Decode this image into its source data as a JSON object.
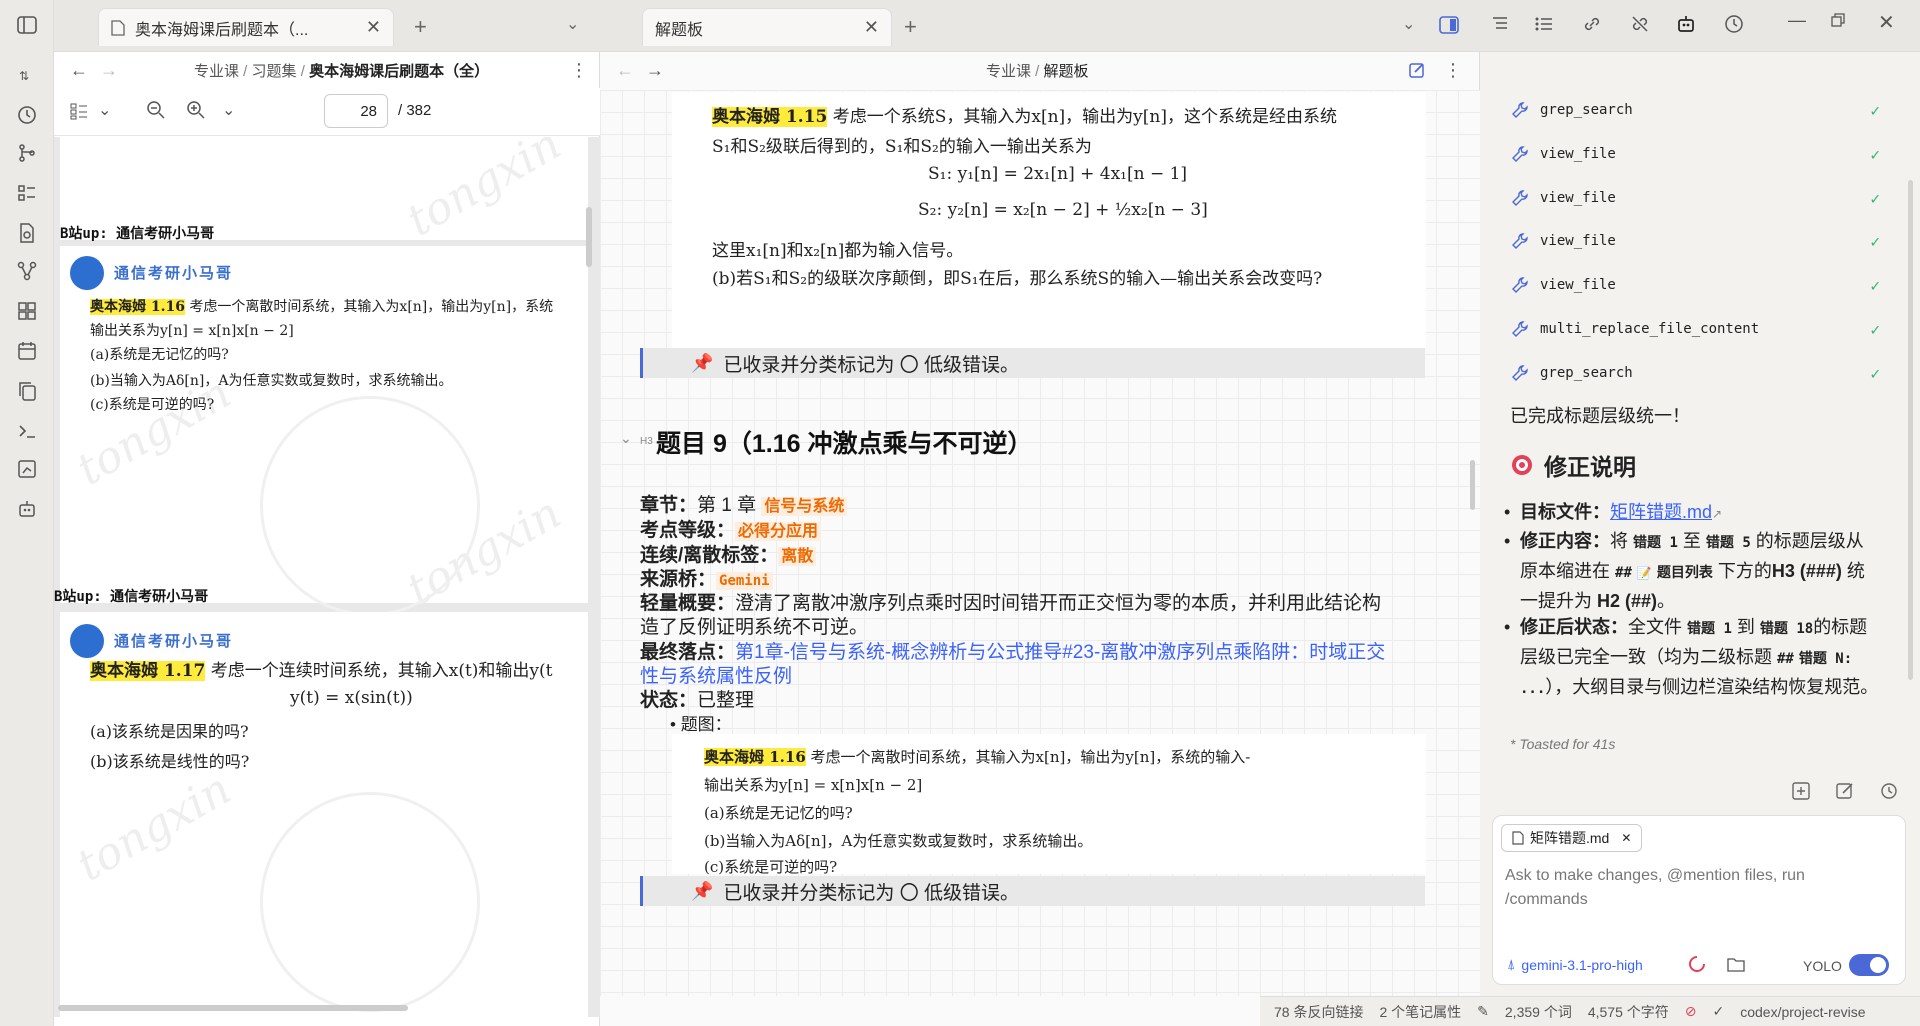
{
  "left_pane": {
    "tab_title": "奥本海姆课后刷题本（...",
    "breadcrumb": [
      "专业课",
      "习题集",
      "奥本海姆课后刷题本（全）"
    ],
    "page_current": "28",
    "page_total": "/ 382",
    "page1": {
      "bup": "B站up: 通信考研小马哥"
    },
    "page2": {
      "ornate": "通信考研小马哥",
      "q_tag": "奥本海姆 1.16",
      "q_line1": "考虑一个离散时间系统，其输入为x[n]，输出为y[n]，系统",
      "q_line2": "输出关系为y[n] = x[n]x[n − 2]",
      "a": "(a)系统是无记忆的吗?",
      "b": "(b)当输入为Aδ[n]，A为任意实数或复数时，求系统输出。",
      "c": "(c)系统是可逆的吗?",
      "bup": "B站up: 通信考研小马哥"
    },
    "page3": {
      "ornate": "通信考研小马哥",
      "q_tag": "奥本海姆 1.17",
      "q_line1": "考虑一个连续时间系统，其输入x(t)和输出y(t",
      "q_eq": "y(t) = x(sin(t))",
      "a": "(a)该系统是因果的吗?",
      "b": "(b)该系统是线性的吗?"
    },
    "watermark": "tongxin"
  },
  "editor": {
    "tab_title": "解题板",
    "breadcrumb": [
      "专业课",
      "解题板"
    ],
    "img1": {
      "q_tag": "奥本海姆 1.15",
      "line1": "考虑一个系统S，其输入为x[n]，输出为y[n]，这个系统是经由系统",
      "line2": "S₁和S₂级联后得到的，S₁和S₂的输入一输出关系为",
      "eq1": "S₁: y₁[n] = 2x₁[n] + 4x₁[n − 1]",
      "eq2": "S₂: y₂[n] = x₂[n − 2] + ½x₂[n − 3]",
      "line3": "这里x₁[n]和x₂[n]都为输入信号。",
      "line4": "(b)若S₁和S₂的级联次序颠倒，即S₁在后，那么系统S的输入—输出关系会改变吗?"
    },
    "callout1": "已收录并分类标记为 〇 低级错误。",
    "heading_marker": "H3",
    "heading": "题目 9（1.16 冲激点乘与不可逆）",
    "fields": {
      "chapter_label": "章节：",
      "chapter_value": "第 1 章 ",
      "chapter_tag": "信号与系统",
      "level_label": "考点等级：",
      "level_tag": "必得分应用",
      "cd_label": "连续/离散标签：",
      "cd_tag": "离散",
      "source_label": "来源桥：",
      "source_tag": "Gemini",
      "summary_label": "轻量概要：",
      "summary_l1": "澄清了离散冲激序列点乘时因时间错开而正交恒为零的本质，并利用此结论构",
      "summary_l2": "造了反例证明系统不可逆。",
      "final_label": "最终落点：",
      "final_l1": "第1章-信号与系统-概念辨析与公式推导#23-离散冲激序列点乘陷阱：时域正交",
      "final_l2": "性与系统属性反例",
      "status_label": "状态：",
      "status_value": "已整理",
      "img_label": "题图："
    },
    "img2": {
      "q_tag": "奥本海姆 1.16",
      "line1": "考虑一个离散时间系统，其输入为x[n]，输出为y[n]，系统的输入-",
      "line2": "输出关系为y[n] = x[n]x[n − 2]",
      "a": "(a)系统是无记忆的吗?",
      "b": "(b)当输入为Aδ[n]，A为任意实数或复数时，求系统输出。",
      "c": "(c)系统是可逆的吗?"
    },
    "callout2": "已收录并分类标记为 〇 低级错误。"
  },
  "agent": {
    "tools": [
      "grep_search",
      "view_file",
      "view_file",
      "view_file",
      "view_file",
      "multi_replace_file_content",
      "grep_search"
    ],
    "done_msg": "已完成标题层级统一！",
    "section_icon": "target-icon",
    "section_title": "修正说明",
    "b1_label": "目标文件：",
    "b1_link": "矩阵错题.md",
    "b2_label": "修正内容：",
    "b2_t1": "将 ",
    "b2_m1": "错题 1",
    "b2_t2": " 至 ",
    "b2_m2": "错题 5",
    "b2_t3": " 的标题层级从原本缩进在 ",
    "b2_m3": "##",
    "b2_m4": "题目列表",
    "b2_t4": " 下方的",
    "b2_m5": "H3 (###)",
    "b2_t5": " 统一提升为 ",
    "b2_m6": "H2 (##)",
    "b2_t6": "。",
    "b3_label": "修正后状态：",
    "b3_t1": "全文件 ",
    "b3_m1": "错题 1",
    "b3_t2": " 到 ",
    "b3_m2": "错题 18",
    "b3_t3": "的标题层级已完全一致（均为二级标题 ",
    "b3_m3": "##",
    "b3_m4": "错题 N: ...",
    "b3_t4": "），大纲目录与侧边栏渲染结构恢复规范。",
    "toasted": "* Toasted for 41s",
    "chip": "矩阵错题.md",
    "placeholder": "Ask to make changes, @mention files,  run /commands",
    "model": "gemini-3.1-pro-high",
    "yolo": "YOLO"
  },
  "status": {
    "backlinks": "78 条反向链接",
    "props": "2 个笔记属性",
    "words": "2,359 个词",
    "chars": "4,575 个字符",
    "branch": "codex/project-revise"
  }
}
